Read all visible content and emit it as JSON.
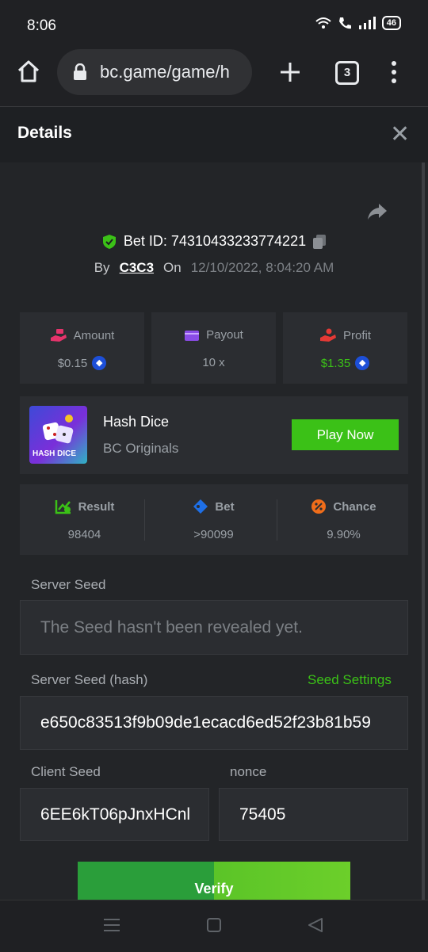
{
  "status": {
    "time": "8:06",
    "battery": "46"
  },
  "browser": {
    "url": "bc.game/game/h",
    "tab_count": "3"
  },
  "details": {
    "title": "Details",
    "close_glyph": "✕"
  },
  "bet": {
    "id_label": "Bet ID: 74310433233774221",
    "by_label": "By",
    "user": "C3C3",
    "on_label": "On",
    "date": "12/10/2022, 8:04:20 AM"
  },
  "stats": [
    {
      "label": "Amount",
      "value": "$0.15",
      "icon": "money-hand-icon",
      "color": "#e5336b"
    },
    {
      "label": "Payout",
      "value": "10 x",
      "icon": "wallet-icon",
      "color": "#8a4ce6"
    },
    {
      "label": "Profit",
      "value": "$1.35",
      "icon": "profit-hand-icon",
      "color": "#e53935",
      "value_color": "#3bc117"
    }
  ],
  "game": {
    "thumb_text": "HASH DICE",
    "name": "Hash Dice",
    "provider": "BC Originals",
    "play_label": "Play Now"
  },
  "result": [
    {
      "label": "Result",
      "value": "98404",
      "icon": "chart-check-icon",
      "color": "#3bc117"
    },
    {
      "label": "Bet",
      "value": ">90099",
      "icon": "tag-icon",
      "color": "#1e6fe6"
    },
    {
      "label": "Chance",
      "value": "9.90%",
      "icon": "percent-icon",
      "color": "#f06d1a"
    }
  ],
  "seeds": {
    "server_seed_label": "Server Seed",
    "server_seed_value": "The Seed hasn't been revealed yet.",
    "server_hash_label": "Server Seed (hash)",
    "seed_settings_label": "Seed Settings",
    "server_hash_value": "e650c83513f9b09de1ecacd6ed52f23b81b59",
    "client_seed_label": "Client Seed",
    "client_seed_value": "6EE6kT06pJnxHCnl",
    "nonce_label": "nonce",
    "nonce_value": "75405"
  },
  "verify_label": "Verify"
}
